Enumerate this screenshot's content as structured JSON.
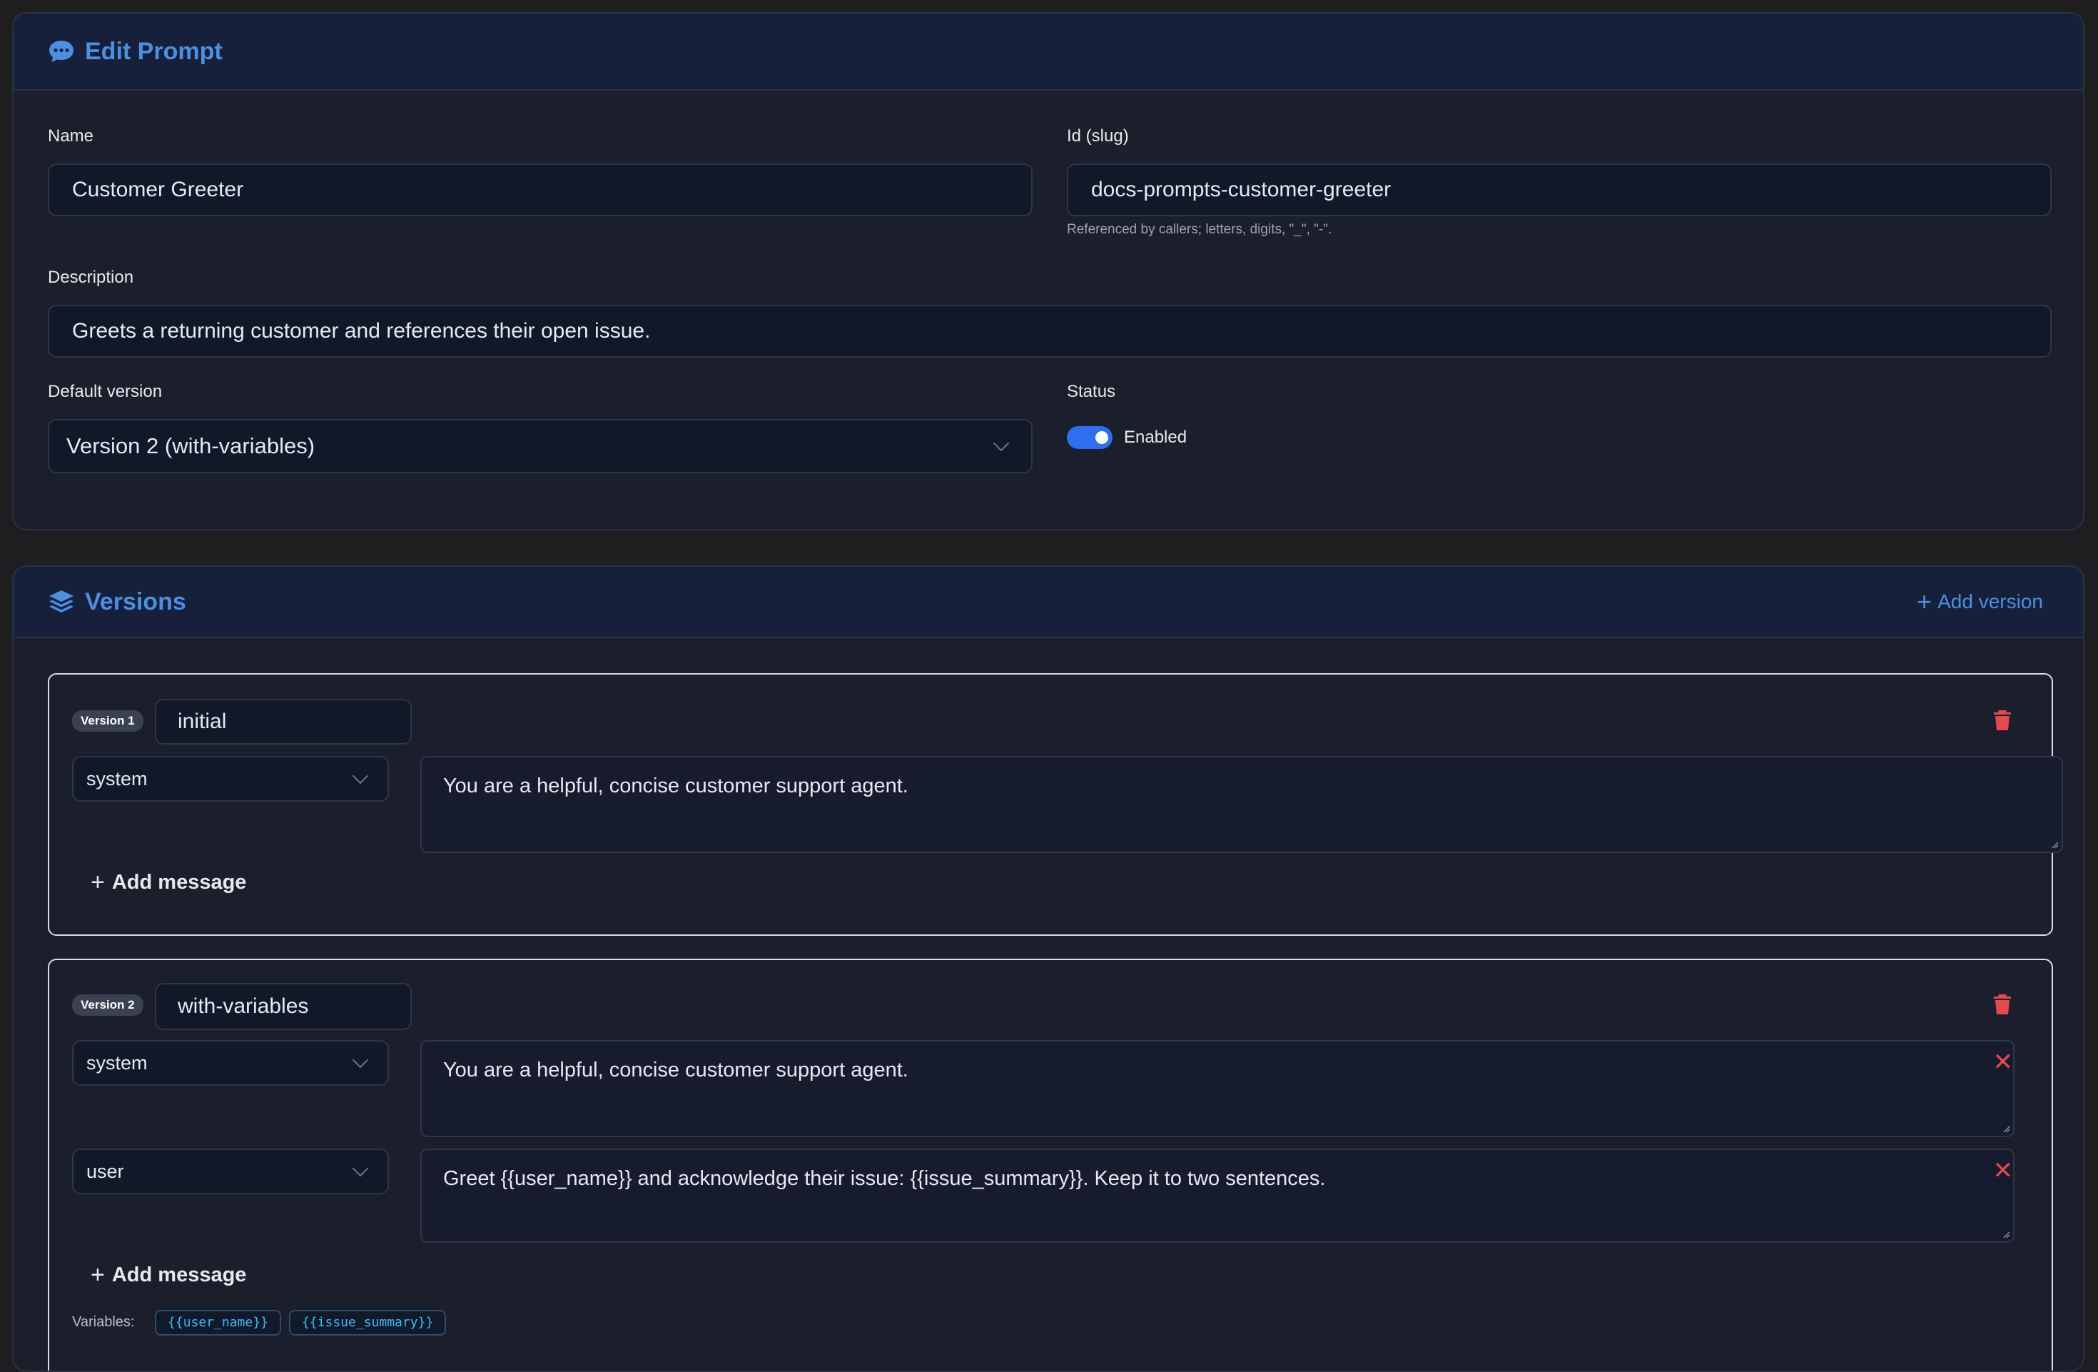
{
  "edit_prompt": {
    "title": "Edit Prompt",
    "name_label": "Name",
    "name_value": "Customer Greeter",
    "id_label": "Id (slug)",
    "id_value": "docs-prompts-customer-greeter",
    "id_help": "Referenced by callers; letters, digits, \"_\", \"-\".",
    "description_label": "Description",
    "description_value": "Greets a returning customer and references their open issue.",
    "default_version_label": "Default version",
    "default_version_value": "Version 2 (with-variables)",
    "status_label": "Status",
    "status_value": "Enabled",
    "status_enabled": true
  },
  "versions": {
    "title": "Versions",
    "add_version_label": "Add version",
    "add_message_label": "Add message",
    "variables_label": "Variables:",
    "items": [
      {
        "badge": "Version 1",
        "name": "initial",
        "messages": [
          {
            "role": "system",
            "content": "You are a helpful, concise customer support agent."
          }
        ]
      },
      {
        "badge": "Version 2",
        "name": "with-variables",
        "messages": [
          {
            "role": "system",
            "content": "You are a helpful, concise customer support agent."
          },
          {
            "role": "user",
            "content": "Greet {{user_name}} and acknowledge their issue: {{issue_summary}}. Keep it to two sentences."
          }
        ],
        "variables": [
          "{{user_name}}",
          "{{issue_summary}}"
        ]
      }
    ]
  },
  "colors": {
    "accent": "#4a90e2",
    "danger": "#e5484d",
    "toggle_on": "#2d6ff0",
    "variable": "#38bdf8"
  },
  "icons": [
    "chat-icon",
    "layers-icon",
    "plus-icon",
    "trash-icon",
    "close-icon",
    "chevron-down-icon"
  ]
}
